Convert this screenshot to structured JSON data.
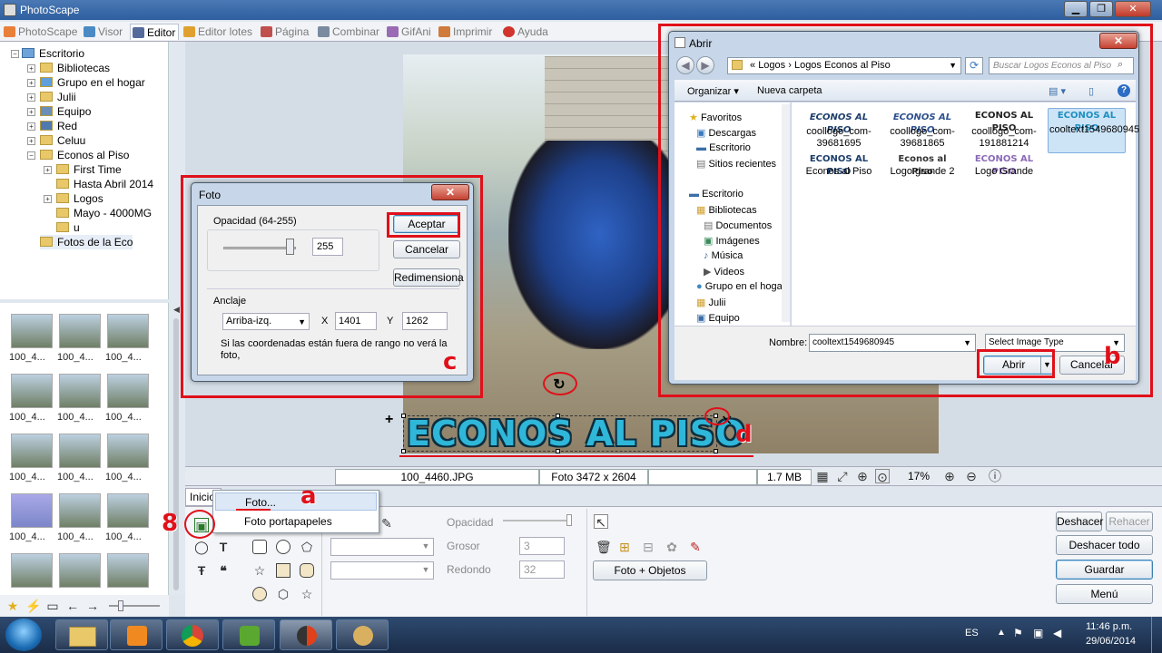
{
  "app": {
    "title": "PhotoScape"
  },
  "tabs": [
    "PhotoScape",
    "Visor",
    "Editor",
    "Editor lotes",
    "Página",
    "Combinar",
    "GifAni",
    "Imprimir",
    "Ayuda"
  ],
  "active_tab": "Editor",
  "tree": {
    "root": "Escritorio",
    "items": [
      "Bibliotecas",
      "Grupo en el hogar",
      "Julii",
      "Equipo",
      "Red",
      "Celuu",
      "Econos al Piso",
      "First Time",
      "Hasta Abril 2014",
      "Logos",
      "Mayo - 4000MG",
      "u",
      "Fotos de la Eco"
    ]
  },
  "thumbs": {
    "label": "100_4..."
  },
  "status": {
    "filename": "100_4460.JPG",
    "dims": "Foto 3472 x 2604",
    "size": "1.7 MB",
    "zoom": "17%"
  },
  "image_text": "ECONOS AL PISO",
  "bottom_tab": "Inicio",
  "context_menu": {
    "item1": "Foto...",
    "item2": "Foto portapapeles"
  },
  "tools": {
    "opacity_label": "Opacidad",
    "grosor_label": "Grosor",
    "grosor_value": "3",
    "redondo_label": "Redondo",
    "redondo_value": "32",
    "photo_objects": "Foto + Objetos"
  },
  "right_buttons": {
    "undo": "Deshacer",
    "redo": "Rehacer",
    "undo_all": "Deshacer todo",
    "save": "Guardar",
    "menu": "Menú"
  },
  "foto_dialog": {
    "title": "Foto",
    "opacity_label": "Opacidad (64-255)",
    "opacity_value": "255",
    "accept": "Aceptar",
    "cancel": "Cancelar",
    "resize": "Redimensiona",
    "anchor_label": "Anclaje",
    "anchor_value": "Arriba-izq.",
    "x_label": "X",
    "x_value": "1401",
    "y_label": "Y",
    "y_value": "1262",
    "note": "Si las coordenadas están fuera de rango no verá la foto,"
  },
  "open_dialog": {
    "title": "Abrir",
    "path": [
      "Logos",
      "Logos Econos al Piso"
    ],
    "search_placeholder": "Buscar Logos Econos al Piso",
    "organize": "Organizar",
    "new_folder": "Nueva carpeta",
    "nav": [
      "Favoritos",
      "Descargas",
      "Escritorio",
      "Sitios recientes",
      "Escritorio",
      "Bibliotecas",
      "Documentos",
      "Imágenes",
      "Música",
      "Videos",
      "Grupo en el hogar",
      "Julii",
      "Equipo"
    ],
    "files": [
      {
        "logo": "ECONOS AL PISO",
        "name": "coollogo_com-39681695"
      },
      {
        "logo": "ECONOS AL PISO",
        "name": "coollogo_com-39681865"
      },
      {
        "logo": "ECONOS AL PISO",
        "name": "coollogo_com-191881214"
      },
      {
        "logo": "ECONOS AL PISO",
        "name": "cooltext1549680945"
      },
      {
        "logo": "ECONOS AL PISO",
        "name": "Econos al Piso"
      },
      {
        "logo": "Econos al Piso",
        "name": "Logo grande 2"
      },
      {
        "logo": "ECONOS AL PISO",
        "name": "Logo Grande"
      }
    ],
    "name_label": "Nombre:",
    "name_value": "cooltext1549680945",
    "type_value": "Select Image Type",
    "open": "Abrir",
    "cancel": "Cancelar"
  },
  "annotations": {
    "a": "a",
    "b": "b",
    "c": "c",
    "d": "d",
    "eight": "8"
  },
  "taskbar": {
    "lang": "ES",
    "time": "11:46 p.m.",
    "date": "29/06/2014"
  }
}
